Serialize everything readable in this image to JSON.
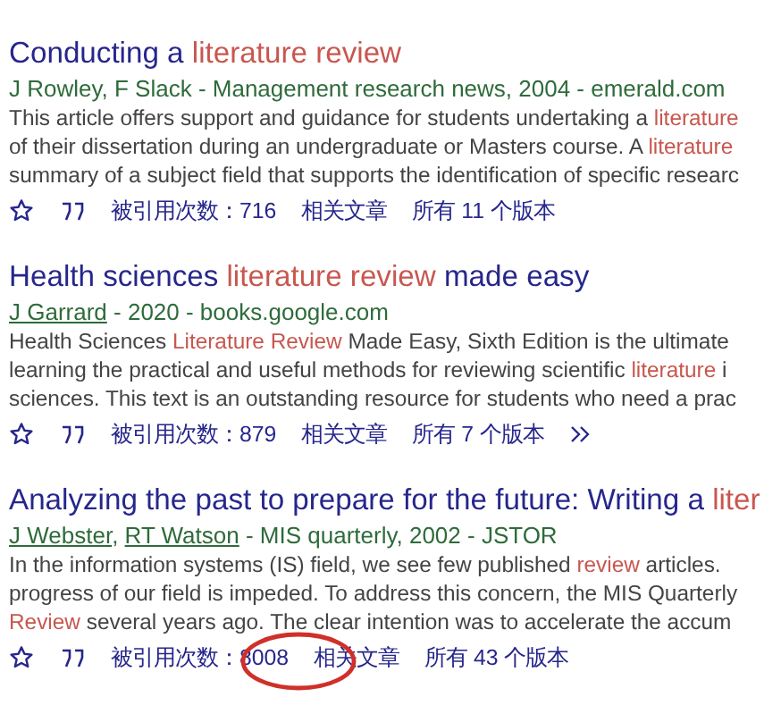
{
  "results": [
    {
      "title": [
        {
          "text": "Conducting a ",
          "highlight": false
        },
        {
          "text": "literature review",
          "highlight": true
        }
      ],
      "byline": [
        {
          "text": "J Rowley, F Slack - Management research news, 2004 - emerald.com",
          "link": false
        }
      ],
      "snippet": [
        [
          {
            "text": "This article offers support and guidance for students undertaking a ",
            "highlight": false
          },
          {
            "text": "literature",
            "highlight": true
          }
        ],
        [
          {
            "text": "of their dissertation during an undergraduate or Masters course. A ",
            "highlight": false
          },
          {
            "text": "literature",
            "highlight": true
          }
        ],
        [
          {
            "text": "summary of a subject field that supports the identification of specific researc",
            "highlight": false
          }
        ]
      ],
      "cited": "被引用次数：716",
      "cited_circled": false,
      "related": "相关文章",
      "versions": "所有 11 个版本",
      "more": false
    },
    {
      "title": [
        {
          "text": "Health sciences ",
          "highlight": false
        },
        {
          "text": "literature review",
          "highlight": true
        },
        {
          "text": " made easy",
          "highlight": false
        }
      ],
      "byline": [
        {
          "text": "J Garrard",
          "link": true
        },
        {
          "text": " - 2020 - books.google.com",
          "link": false
        }
      ],
      "snippet": [
        [
          {
            "text": "Health Sciences ",
            "highlight": false
          },
          {
            "text": "Literature Review",
            "highlight": true
          },
          {
            "text": " Made Easy, Sixth Edition is the ultimate",
            "highlight": false
          }
        ],
        [
          {
            "text": "learning the practical and useful methods for reviewing scientific ",
            "highlight": false
          },
          {
            "text": "literature",
            "highlight": true
          },
          {
            "text": " i",
            "highlight": false
          }
        ],
        [
          {
            "text": "sciences. This text is an outstanding resource for students who need a prac",
            "highlight": false
          }
        ]
      ],
      "cited": "被引用次数：879",
      "cited_circled": false,
      "related": "相关文章",
      "versions": "所有 7 个版本",
      "more": true
    },
    {
      "title": [
        {
          "text": "Analyzing the past to prepare for the future: Writing a ",
          "highlight": false
        },
        {
          "text": "liter",
          "highlight": true
        }
      ],
      "byline": [
        {
          "text": "J Webster",
          "link": true
        },
        {
          "text": ", ",
          "link": false
        },
        {
          "text": "RT Watson",
          "link": true
        },
        {
          "text": " - MIS quarterly, 2002 - JSTOR",
          "link": false
        }
      ],
      "snippet": [
        [
          {
            "text": "In the information systems (IS) field, we see few published ",
            "highlight": false
          },
          {
            "text": "review",
            "highlight": true
          },
          {
            "text": " articles.",
            "highlight": false
          }
        ],
        [
          {
            "text": "progress of our field is impeded. To address this concern, the MIS Quarterly",
            "highlight": false
          }
        ],
        [
          {
            "text": "Review",
            "highlight": true
          },
          {
            "text": " several years ago. The clear intention was to accelerate the accum",
            "highlight": false
          }
        ]
      ],
      "cited": "被引用次数：8008",
      "cited_circled": true,
      "related": "相关文章",
      "versions": "所有 43 个版本",
      "more": false
    }
  ]
}
